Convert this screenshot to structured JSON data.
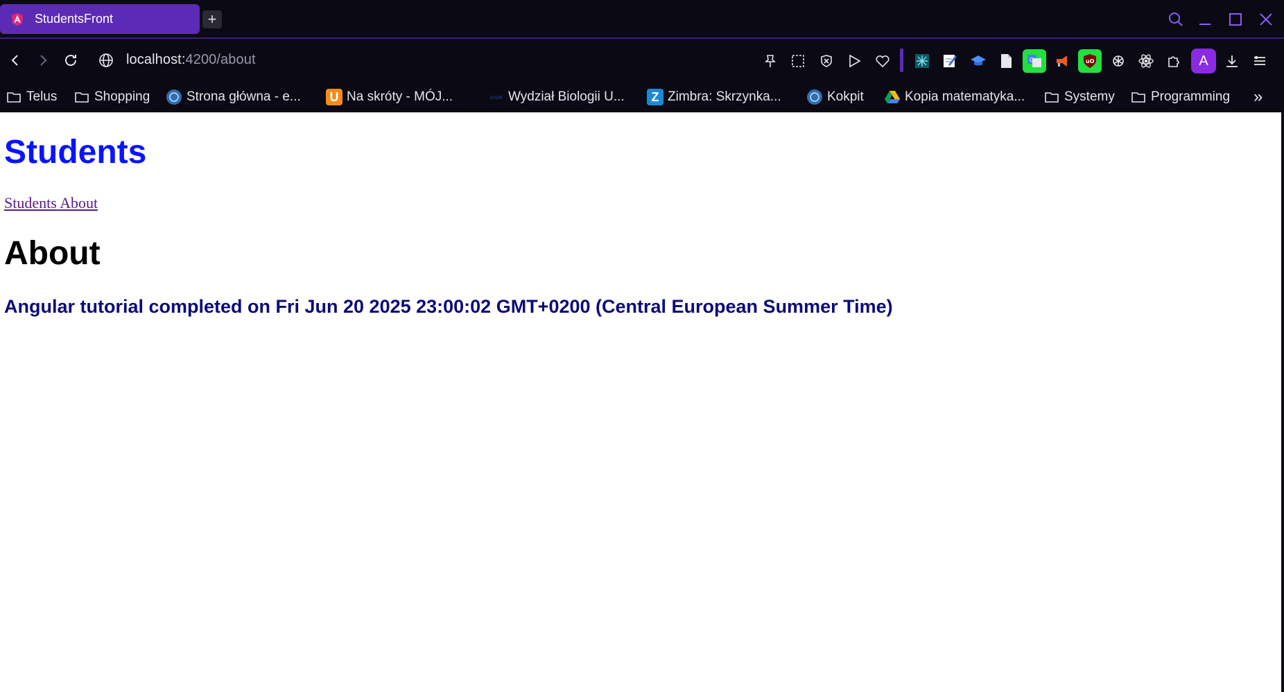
{
  "browser": {
    "tab": {
      "title": "StudentsFront",
      "new_tab_label": "+"
    },
    "address": {
      "host": "localhost:",
      "rest": "4200/about"
    },
    "bookmarks": [
      {
        "label": "Telus",
        "icon": "folder-icon"
      },
      {
        "label": "Shopping",
        "icon": "folder-icon"
      },
      {
        "label": "Strona główna - e...",
        "icon": "university-seal-icon"
      },
      {
        "label": "Na skróty - MÓJ...",
        "icon": "u-badge-icon"
      },
      {
        "label": "Wydział Biologii U...",
        "icon": "faculty-logo-icon"
      },
      {
        "label": "Zimbra: Skrzynka...",
        "icon": "zimbra-icon"
      },
      {
        "label": "Kokpit",
        "icon": "university-seal-icon"
      },
      {
        "label": "Kopia matematyka...",
        "icon": "google-drive-icon"
      },
      {
        "label": "Systemy",
        "icon": "folder-icon"
      },
      {
        "label": "Programming",
        "icon": "folder-icon"
      }
    ],
    "profile_letter": "A",
    "zimbra_letter": "Z",
    "u_letter": "U",
    "overflow": "»"
  },
  "page": {
    "app_title": "Students",
    "links": [
      "Students",
      "About"
    ],
    "heading": "About",
    "completed_text": "Angular tutorial completed on Fri Jun 20 2025 23:00:02 GMT+0200 (Central European Summer Time)"
  }
}
